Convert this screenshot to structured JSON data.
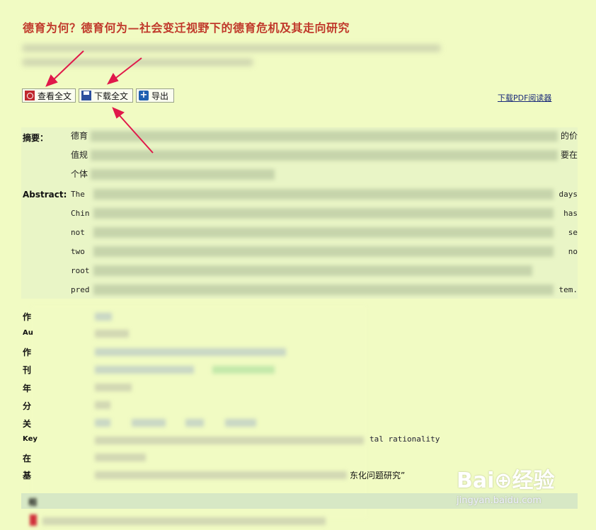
{
  "article": {
    "title": "德育为何？德育何为—社会变迁视野下的德育危机及其走向研究"
  },
  "toolbar": {
    "view_full_text": "查看全文",
    "download_full_text": "下载全文",
    "export": "导出",
    "download_pdf_reader": "下载PDF阅读器"
  },
  "abstract_zh": {
    "label": "摘要：",
    "line1_start": "德育",
    "line1_end": "的价",
    "line2_start": "值规",
    "line2_end": "要在",
    "line3_start": "个体"
  },
  "abstract_en": {
    "label": "Abstract:",
    "lines": [
      {
        "start": "The",
        "end": "days"
      },
      {
        "start": "Chin",
        "end": "has"
      },
      {
        "start": "not",
        "end": "se"
      },
      {
        "start": "two",
        "end": "no"
      },
      {
        "start": "root",
        "end": ""
      },
      {
        "start": "pred",
        "end": "tem."
      }
    ]
  },
  "meta": {
    "author_label": "作",
    "author_en_label": "Au",
    "affiliation_label": "作",
    "journal_label": "刊",
    "year_label": "年",
    "class_label": "分",
    "keywords_label": "关",
    "keywords_en_label": "Key",
    "keywords_en_tail": "tal rationality",
    "online_label": "在",
    "fund_label": "基",
    "fund_tail": "东化问题研究”",
    "related_label": "相"
  },
  "watermark": {
    "brand": "Bai⊕经验",
    "sub": "jingyan.baidu.com"
  },
  "colors": {
    "background": "#f1fbc3",
    "title": "#c0392b",
    "arrow": "#e0194a",
    "link": "#1a2a7a"
  }
}
